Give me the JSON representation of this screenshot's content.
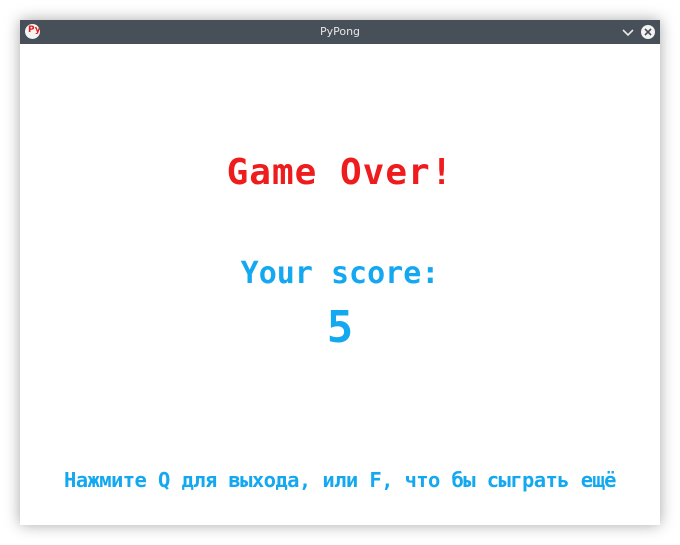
{
  "window": {
    "title": "PyPong",
    "app_icon_name": "pypong-app-icon",
    "app_icon_text": "Py"
  },
  "titlebar_buttons": {
    "minimize_icon": "chevron-down-icon",
    "close_icon": "close-icon"
  },
  "game": {
    "game_over_text": "Game Over!",
    "score_label": "Your score:",
    "score_value": "5",
    "hint_text": "Нажмите Q для выхода, или F, что бы сыграть ещё"
  },
  "colors": {
    "titlebar_bg": "#474f58",
    "game_over_color": "#ee1c1c",
    "score_color": "#14a8f0",
    "background": "#ffffff"
  }
}
